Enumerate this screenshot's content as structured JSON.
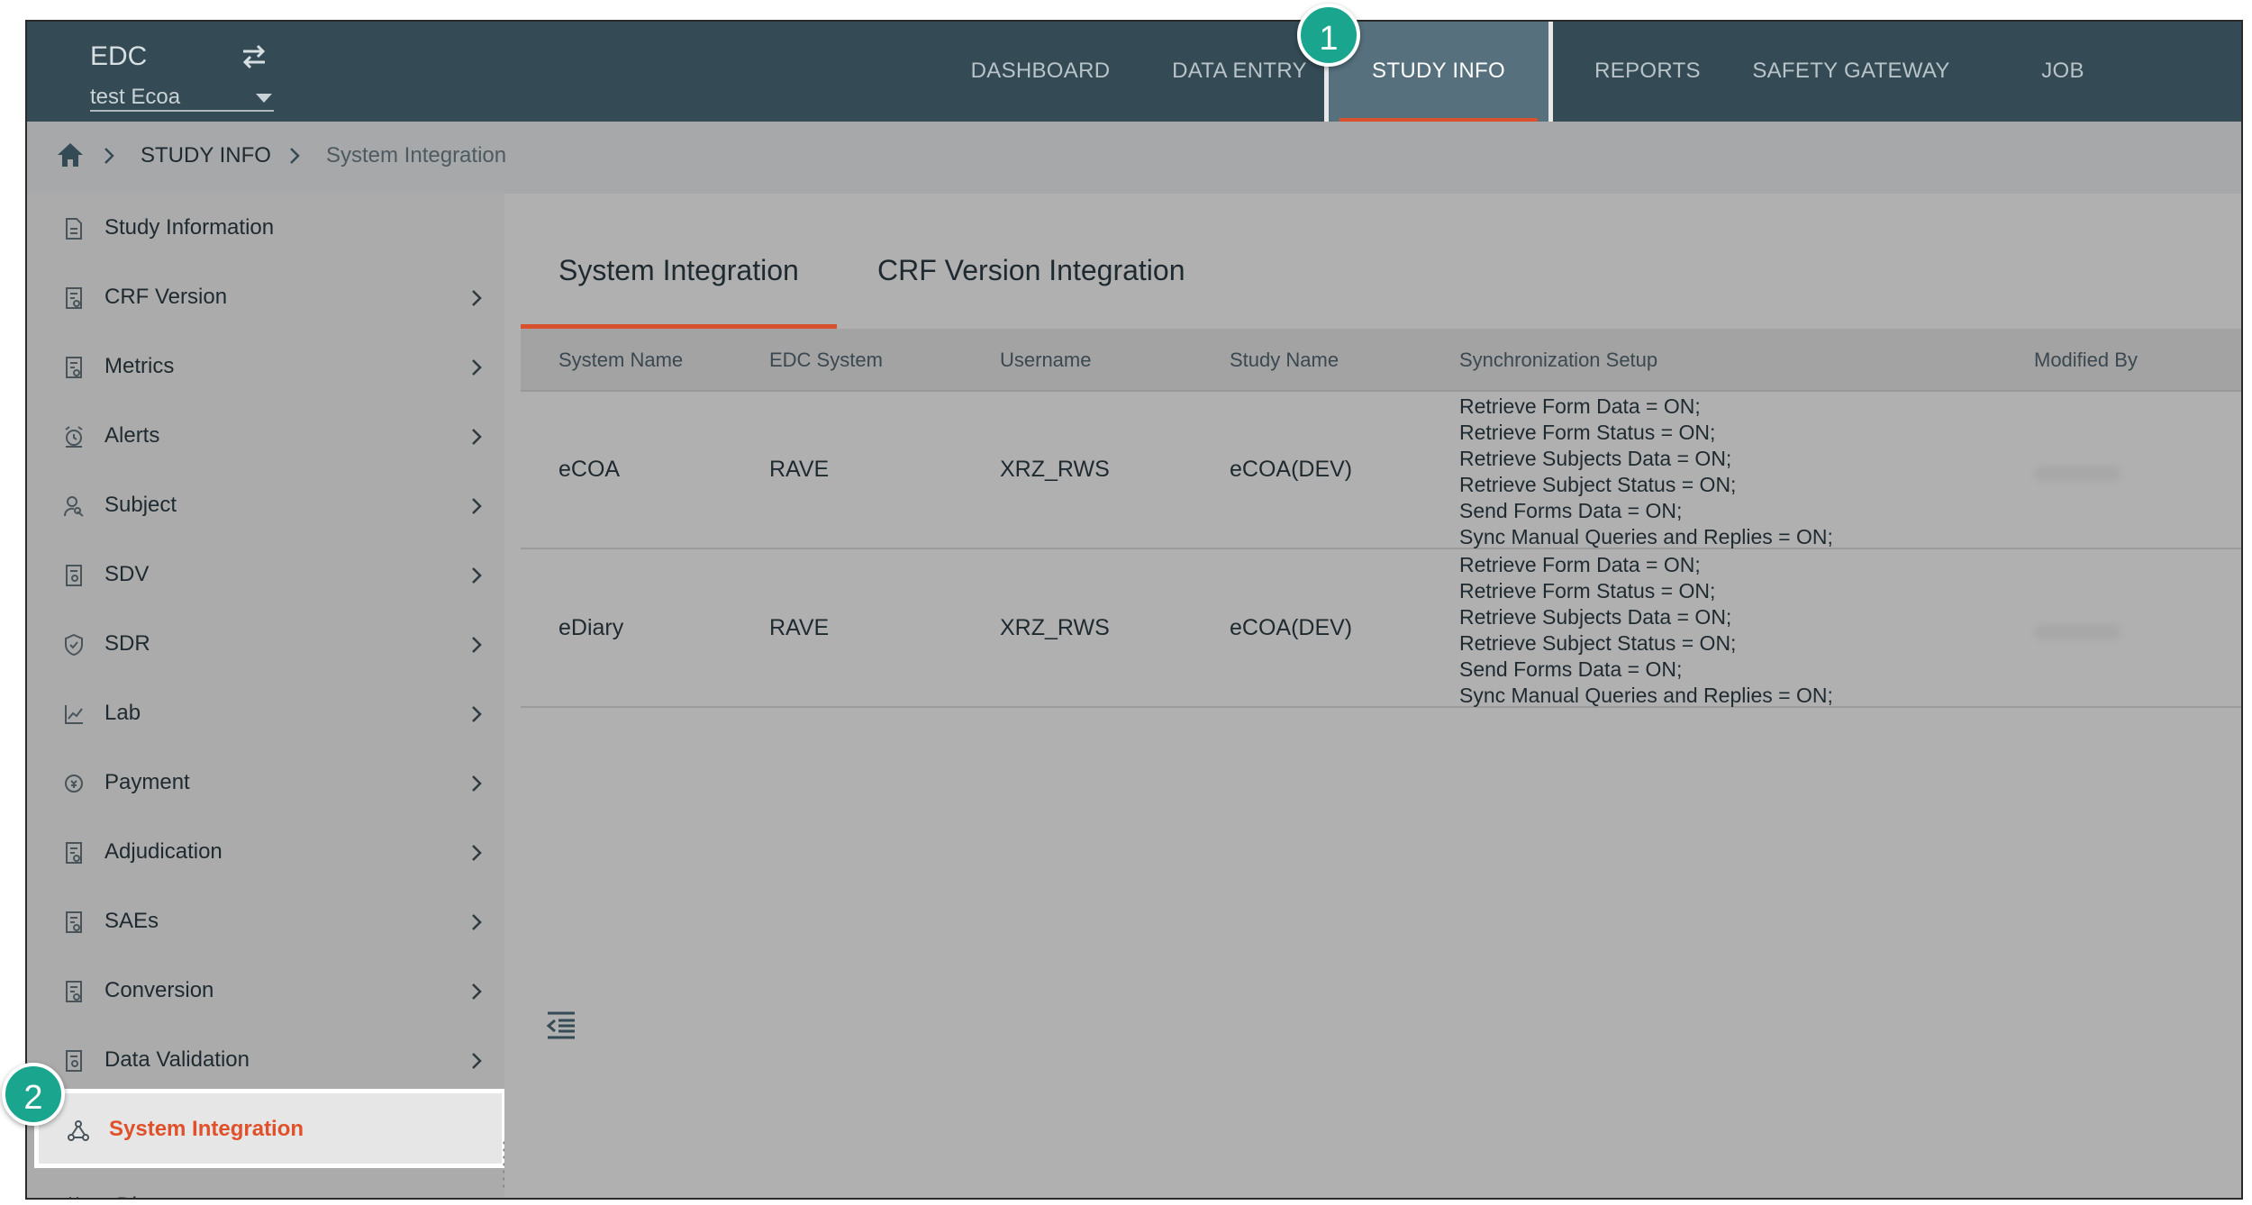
{
  "header": {
    "brand": "EDC",
    "study_selector": "test Ecoa",
    "nav": [
      {
        "label": "DASHBOARD"
      },
      {
        "label": "DATA ENTRY"
      },
      {
        "label": "STUDY INFO"
      },
      {
        "label": "REPORTS"
      },
      {
        "label": "SAFETY GATEWAY"
      },
      {
        "label": "JOB"
      }
    ],
    "active_nav": "STUDY INFO"
  },
  "breadcrumb": {
    "items": [
      "STUDY INFO",
      "System Integration"
    ]
  },
  "sidebar": {
    "items": [
      {
        "label": "Study Information"
      },
      {
        "label": "CRF Version"
      },
      {
        "label": "Metrics"
      },
      {
        "label": "Alerts"
      },
      {
        "label": "Subject"
      },
      {
        "label": "SDV"
      },
      {
        "label": "SDR"
      },
      {
        "label": "Lab"
      },
      {
        "label": "Payment"
      },
      {
        "label": "Adjudication"
      },
      {
        "label": "SAEs"
      },
      {
        "label": "Conversion"
      },
      {
        "label": "Data Validation"
      },
      {
        "label": "System Integration"
      },
      {
        "label": "eDiary"
      }
    ],
    "selected": "System Integration"
  },
  "main": {
    "tabs": [
      {
        "label": "System Integration"
      },
      {
        "label": "CRF Version Integration"
      }
    ],
    "active_tab": "System Integration",
    "table": {
      "columns": [
        "System Name",
        "EDC System",
        "Username",
        "Study Name",
        "Synchronization Setup",
        "Modified By"
      ],
      "rows": [
        {
          "system_name": "eCOA",
          "edc_system": "RAVE",
          "username": "XRZ_RWS",
          "study_name": "eCOA(DEV)",
          "sync": [
            "Retrieve Form Data = ON;",
            "Retrieve Form Status = ON;",
            "Retrieve Subjects Data = ON;",
            "Retrieve Subject Status = ON;",
            "Send Forms Data = ON;",
            "Sync Manual Queries and Replies = ON;"
          ]
        },
        {
          "system_name": "eDiary",
          "edc_system": "RAVE",
          "username": "XRZ_RWS",
          "study_name": "eCOA(DEV)",
          "sync": [
            "Retrieve Form Data = ON;",
            "Retrieve Form Status = ON;",
            "Retrieve Subjects Data = ON;",
            "Retrieve Subject Status = ON;",
            "Send Forms Data = ON;",
            "Sync Manual Queries and Replies = ON;"
          ]
        }
      ]
    }
  },
  "callouts": [
    "1",
    "2"
  ],
  "colors": {
    "header_bg": "#344a55",
    "accent": "#d9512c",
    "callout": "#1aa58e"
  }
}
